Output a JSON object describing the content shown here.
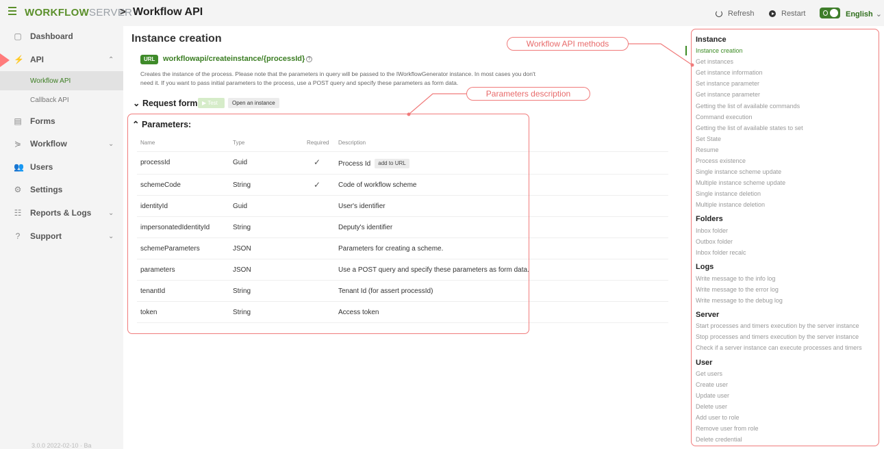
{
  "header": {
    "logo_bold": "WORKFLOW",
    "logo_light": "SERVER",
    "separator": ">",
    "page_name": "Workflow API",
    "refresh_label": "Refresh",
    "restart_label": "Restart",
    "language": "English"
  },
  "sidebar": {
    "items": [
      {
        "label": "Dashboard",
        "icon": "dashboard-icon"
      },
      {
        "label": "API",
        "icon": "plug-icon"
      },
      {
        "label": "Forms",
        "icon": "forms-icon"
      },
      {
        "label": "Workflow",
        "icon": "workflow-icon"
      },
      {
        "label": "Users",
        "icon": "users-icon"
      },
      {
        "label": "Settings",
        "icon": "settings-icon"
      },
      {
        "label": "Reports & Logs",
        "icon": "reports-icon"
      },
      {
        "label": "Support",
        "icon": "support-icon"
      }
    ],
    "api_sub": [
      "Workflow API",
      "Callback API"
    ],
    "version": "3.0.0 2022-02-10 · Ba"
  },
  "main": {
    "title": "Instance creation",
    "url_badge": "URL",
    "url_path": "workflowapi/createinstance/{processId}",
    "description": "Creates the instance of the process. Please note that the parameters in query will be passed to the IWorkflowGenerator instance. In most cases you don't need it. If you want to pass initial parameters to the process, use a POST query and specify these parameters as form data.",
    "request_form": "Request form",
    "test_label": "▶ Test",
    "open_instance": "Open an instance",
    "params_title": "Parameters:",
    "columns": {
      "name": "Name",
      "type": "Type",
      "required": "Required",
      "description": "Description"
    },
    "params": [
      {
        "name": "processId",
        "type": "Guid",
        "required": true,
        "description": "Process Id",
        "extra": "add to URL"
      },
      {
        "name": "schemeCode",
        "type": "String",
        "required": true,
        "description": "Code of workflow scheme"
      },
      {
        "name": "identityId",
        "type": "Guid",
        "required": false,
        "description": "User's identifier"
      },
      {
        "name": "impersonatedIdentityId",
        "type": "String",
        "required": false,
        "description": "Deputy's identifier"
      },
      {
        "name": "schemeParameters",
        "type": "JSON",
        "required": false,
        "description": "Parameters for creating a scheme."
      },
      {
        "name": "parameters",
        "type": "JSON",
        "required": false,
        "description": "Use a POST query and specify these parameters as form data."
      },
      {
        "name": "tenantId",
        "type": "String",
        "required": false,
        "description": "Tenant Id (for assert processId)"
      },
      {
        "name": "token",
        "type": "String",
        "required": false,
        "description": "Access token"
      }
    ]
  },
  "annotations": {
    "methods": "Workflow API methods",
    "params": "Parameters description",
    "color": "#f07a7a"
  },
  "right_nav": {
    "sections": [
      {
        "title": "Instance",
        "links": [
          "Instance creation",
          "Get instances",
          "Get instance information",
          "Set instance parameter",
          "Get instance parameter",
          "Getting the list of available commands",
          "Command execution",
          "Getting the list of available states to set",
          "Set State",
          "Resume",
          "Process existence",
          "Single instance scheme update",
          "Multiple instance scheme update",
          "Single instance deletion",
          "Multiple instance deletion"
        ]
      },
      {
        "title": "Folders",
        "links": [
          "Inbox folder",
          "Outbox folder",
          "Inbox folder recalc"
        ]
      },
      {
        "title": "Logs",
        "links": [
          "Write message to the info log",
          "Write message to the error log",
          "Write message to the debug log"
        ]
      },
      {
        "title": "Server",
        "links": [
          "Start processes and timers execution by the server instance",
          "Stop processes and timers execution by the server instance",
          "Check if a server instance can execute processes and timers"
        ]
      },
      {
        "title": "User",
        "links": [
          "Get users",
          "Create user",
          "Update user",
          "Delete user",
          "Add user to role",
          "Remove user from role",
          "Delete credential"
        ]
      }
    ]
  },
  "colors": {
    "accent": "#3a8a22",
    "annotation": "#f07a7a"
  }
}
